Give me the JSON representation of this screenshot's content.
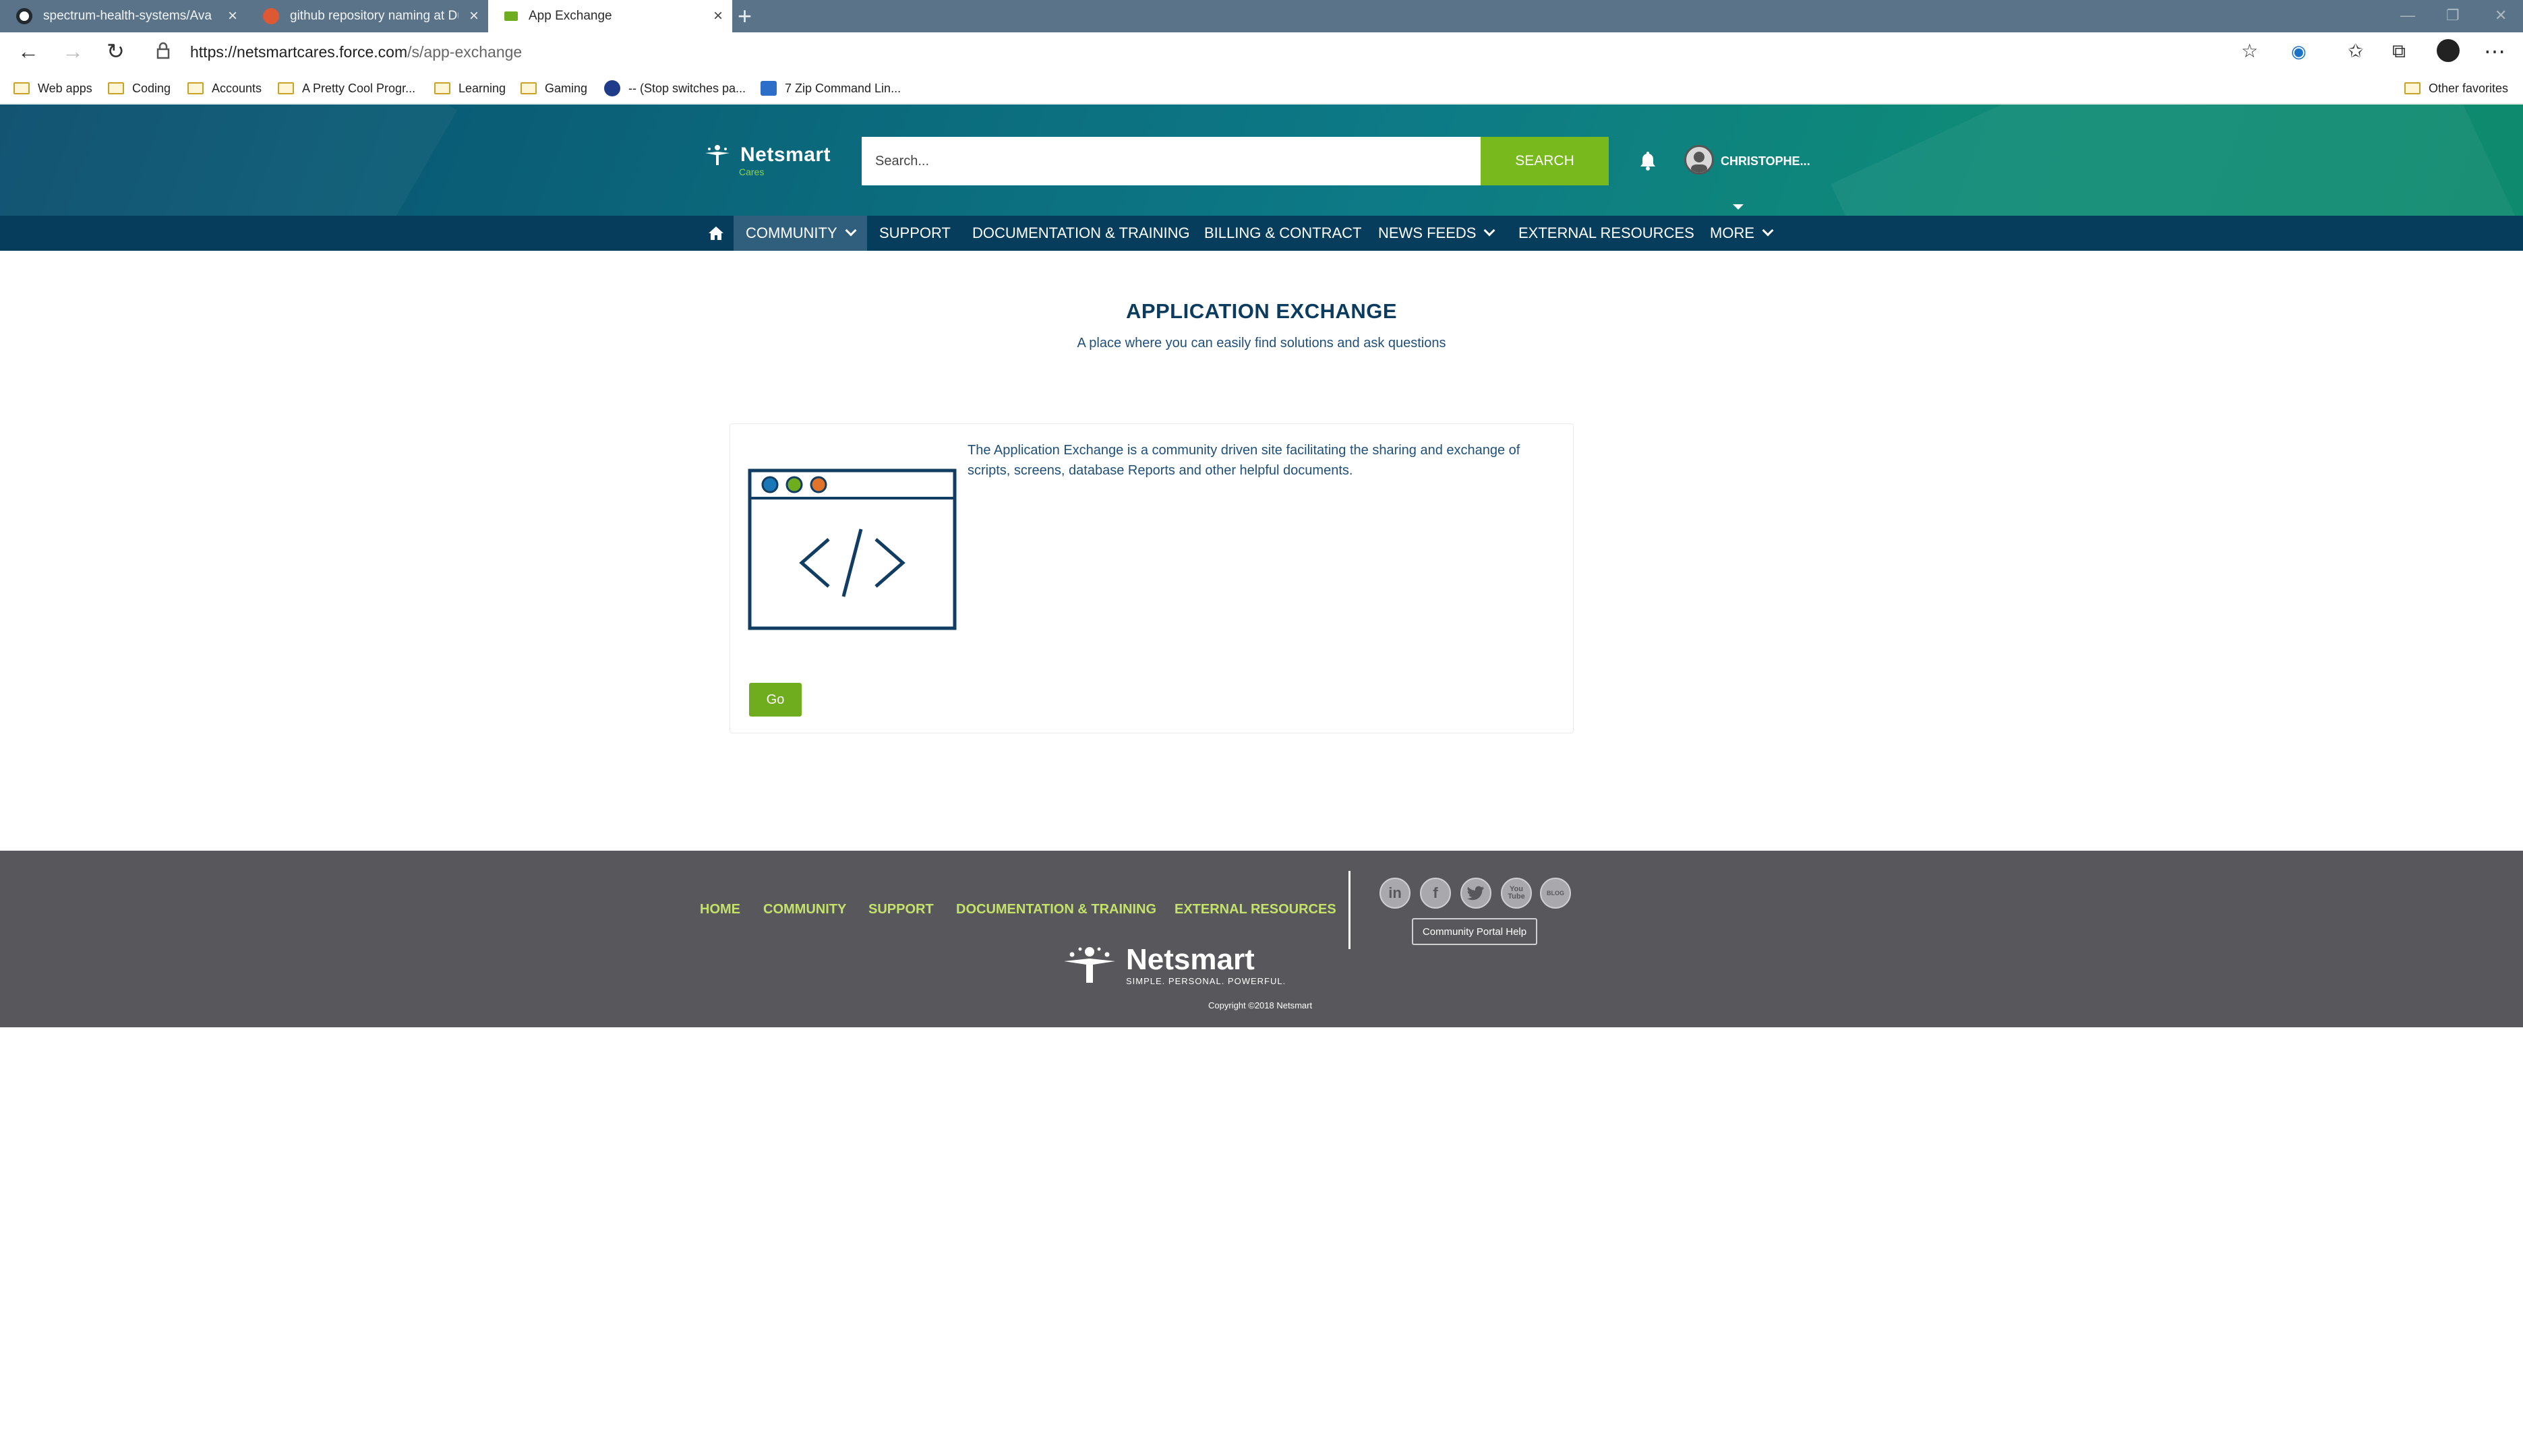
{
  "browser": {
    "tabs": [
      {
        "title": "spectrum-health-systems/Avator",
        "active": false
      },
      {
        "title": "github repository naming at Duc",
        "active": false
      },
      {
        "title": "App Exchange",
        "active": true
      }
    ],
    "url_host": "https://netsmartcares.force.com",
    "url_path": "/s/app-exchange",
    "bookmarks": [
      {
        "label": "Web apps",
        "icon": "folder-icon"
      },
      {
        "label": "Coding",
        "icon": "folder-icon"
      },
      {
        "label": "Accounts",
        "icon": "folder-icon"
      },
      {
        "label": "A Pretty Cool Progr...",
        "icon": "folder-icon"
      },
      {
        "label": "Learning",
        "icon": "folder-icon"
      },
      {
        "label": "Gaming",
        "icon": "folder-icon"
      },
      {
        "label": "-- (Stop switches pa...",
        "icon": "site-icon"
      },
      {
        "label": "7 Zip Command Lin...",
        "icon": "site-icon"
      }
    ],
    "other_favorites": "Other favorites"
  },
  "header": {
    "brand": "Netsmart",
    "brand_sub": "Cares",
    "search_placeholder": "Search...",
    "search_button": "SEARCH",
    "user_name": "CHRISTOPHE..."
  },
  "nav": {
    "items": [
      {
        "label": "COMMUNITY",
        "dropdown": true,
        "active": true
      },
      {
        "label": "SUPPORT",
        "dropdown": false
      },
      {
        "label": "DOCUMENTATION & TRAINING",
        "dropdown": false
      },
      {
        "label": "BILLING & CONTRACT",
        "dropdown": false
      },
      {
        "label": "NEWS FEEDS",
        "dropdown": true
      },
      {
        "label": "EXTERNAL RESOURCES",
        "dropdown": false
      },
      {
        "label": "MORE",
        "dropdown": true
      }
    ]
  },
  "main": {
    "title": "APPLICATION EXCHANGE",
    "subtitle": "A place where you can easily find solutions and ask questions",
    "card": {
      "description": "The Application Exchange is a community driven site facilitating the sharing and exchange of scripts, screens, database Reports and other helpful documents.",
      "button": "Go"
    }
  },
  "footer": {
    "links": [
      "HOME",
      "COMMUNITY",
      "SUPPORT",
      "DOCUMENTATION & TRAINING",
      "EXTERNAL RESOURCES"
    ],
    "social": [
      "linkedin-icon",
      "facebook-icon",
      "twitter-icon",
      "youtube-icon",
      "blog-icon"
    ],
    "social_text": {
      "linkedin": "in",
      "facebook": "f",
      "youtube": "You Tube",
      "blog": "BLOG"
    },
    "help_button": "Community Portal Help",
    "brand": "Netsmart",
    "tagline": "SIMPLE. PERSONAL. POWERFUL.",
    "copyright": "Copyright ©2018 Netsmart"
  },
  "colors": {
    "header_teal": "#0b6b7d",
    "nav_navy": "#073d5c",
    "accent_green": "#78b91e",
    "footer_gray": "#58585c",
    "footer_link": "#c4e26b",
    "title_navy": "#0b3b5e"
  }
}
